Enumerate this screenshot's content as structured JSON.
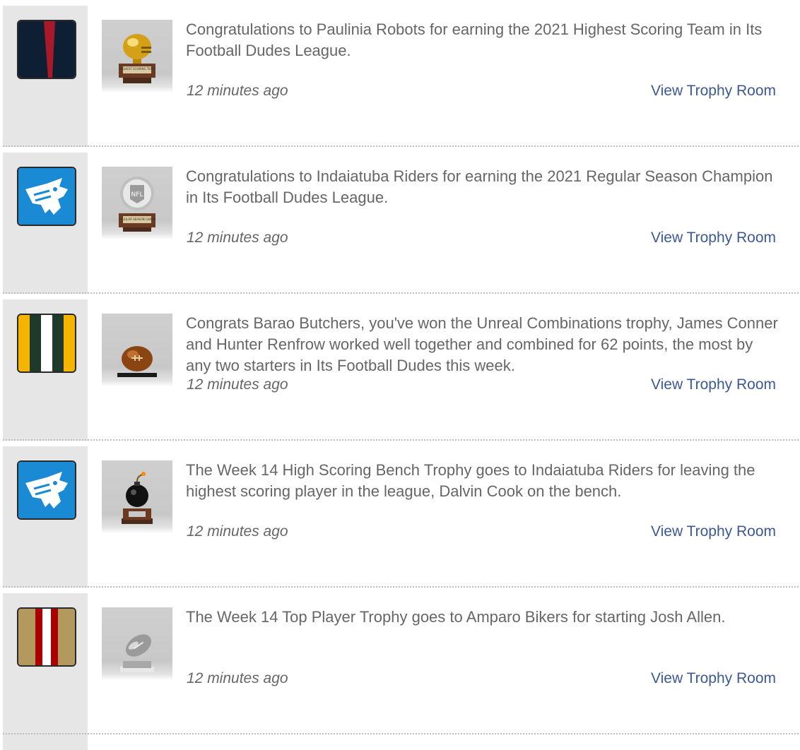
{
  "feed": {
    "items": [
      {
        "message": "Congratulations to Paulinia Robots for earning the 2021 Highest Scoring Team in Its Football Dudes League.",
        "time": "12 minutes ago",
        "link": "View Trophy Room",
        "team_logo": "houston-style-logo",
        "trophy_icon": "gold-helmet-trophy-icon",
        "trophy_plaque": "HIGHEST SCORING TEAM"
      },
      {
        "message": "Congratulations to Indaiatuba Riders for earning the 2021 Regular Season Champion in Its Football Dudes League.",
        "time": "12 minutes ago",
        "link": "View Trophy Room",
        "team_logo": "panther-logo",
        "trophy_icon": "nfl-globe-trophy-icon",
        "trophy_plaque": "REGULAR SEASON CHAMP"
      },
      {
        "message": "Congrats Barao Butchers, you've won the Unreal Combinations trophy, James Conner and Hunter Renfrow worked well together and combined for 62 points, the most by any two starters in Its Football Dudes this week.",
        "time": "12 minutes ago",
        "link": "View Trophy Room",
        "team_logo": "green-gold-stripes-logo",
        "trophy_icon": "football-trophy-icon"
      },
      {
        "message": "The Week 14 High Scoring Bench Trophy goes to Indaiatuba Riders for leaving the highest scoring player in the league, Dalvin Cook on the bench.",
        "time": "12 minutes ago",
        "link": "View Trophy Room",
        "team_logo": "panther-logo",
        "trophy_icon": "bomb-trophy-icon"
      },
      {
        "message": "The Week 14 Top Player Trophy goes to Amparo Bikers for starting Josh Allen.",
        "time": "12 minutes ago",
        "link": "View Trophy Room",
        "team_logo": "gold-red-stripes-logo",
        "trophy_icon": "silver-football-trophy-icon"
      }
    ]
  },
  "colors": {
    "link": "#3b5998",
    "text": "#666666",
    "sidebar": "#e6e6e6",
    "divider": "#bcbcbc"
  }
}
